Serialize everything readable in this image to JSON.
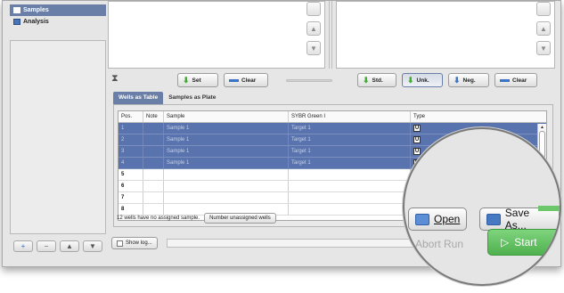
{
  "sidebar": {
    "items": [
      {
        "label": "Samples",
        "icon": "list-icon",
        "active": true
      },
      {
        "label": "Analysis",
        "icon": "chart-icon",
        "active": false
      }
    ],
    "buttons": [
      "+",
      "−",
      "▲",
      "▼"
    ]
  },
  "toolbar": {
    "set_label": "Set",
    "clear_label": "Clear",
    "std_label": "Std.",
    "unk_label": "Unk.",
    "neg_label": "Neg.",
    "clear2_label": "Clear"
  },
  "tabs": [
    {
      "label": "Wells as Table",
      "active": true
    },
    {
      "label": "Samples as Plate",
      "active": false
    }
  ],
  "table": {
    "headers": [
      "Pos.",
      "Note",
      "Sample",
      "SYBR Green I",
      "Type"
    ],
    "rows": [
      {
        "pos": "1",
        "note": "",
        "sample": "Sample 1",
        "sybr": "Target 1",
        "type": "U",
        "selected": true
      },
      {
        "pos": "2",
        "note": "",
        "sample": "Sample 1",
        "sybr": "Target 1",
        "type": "U",
        "selected": true
      },
      {
        "pos": "3",
        "note": "",
        "sample": "Sample 1",
        "sybr": "Target 1",
        "type": "U",
        "selected": true
      },
      {
        "pos": "4",
        "note": "",
        "sample": "Sample 1",
        "sybr": "Target 1",
        "type": "U",
        "selected": true
      },
      {
        "pos": "5",
        "note": "",
        "sample": "",
        "sybr": "",
        "type": "",
        "selected": false
      },
      {
        "pos": "6",
        "note": "",
        "sample": "",
        "sybr": "",
        "type": "",
        "selected": false
      },
      {
        "pos": "7",
        "note": "",
        "sample": "",
        "sybr": "",
        "type": "",
        "selected": false
      },
      {
        "pos": "8",
        "note": "",
        "sample": "",
        "sybr": "",
        "type": "",
        "selected": false
      }
    ]
  },
  "status": {
    "message": "12 wells have no assigned sample.",
    "button_label": "Number unassigned wells"
  },
  "bottom": {
    "show_log_label": "Show log..."
  },
  "magnifier": {
    "open_label": "Open",
    "save_as_label": "Save As...",
    "abort_label": "Abort Run",
    "start_label": "Start"
  },
  "colors": {
    "selection": "#5873ad",
    "tab_active": "#6a7fa8",
    "start_green": "#4fb14f"
  }
}
